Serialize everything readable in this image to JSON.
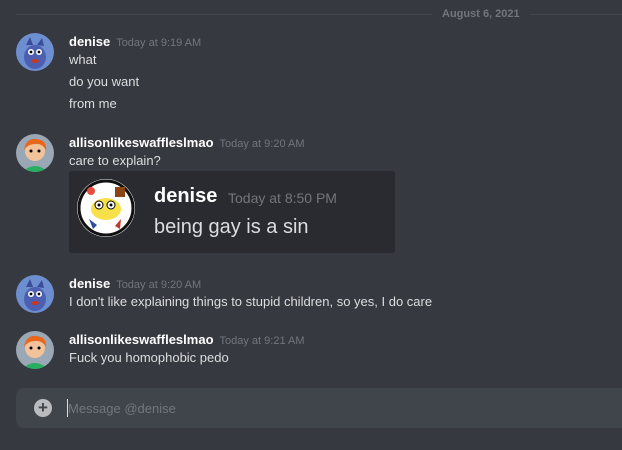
{
  "date_divider": "August 6, 2021",
  "messages": [
    {
      "username": "denise",
      "timestamp": "Today at 9:19 AM",
      "lines": [
        "what",
        "do you want",
        "from me"
      ]
    },
    {
      "username": "allisonlikeswaffleslmao",
      "timestamp": "Today at 9:20 AM",
      "lines": [
        "care to explain?"
      ],
      "embed": {
        "username": "denise",
        "timestamp": "Today at 8:50 PM",
        "text": "being gay is a sin"
      }
    },
    {
      "username": "denise",
      "timestamp": "Today at 9:20 AM",
      "lines": [
        "I don't like explaining things to stupid children, so yes, I do care"
      ]
    },
    {
      "username": "allisonlikeswaffleslmao",
      "timestamp": "Today at 9:21 AM",
      "lines": [
        "Fuck you homophobic pedo"
      ]
    }
  ],
  "composer": {
    "placeholder": "Message @denise",
    "add_icon": "+"
  },
  "colors": {
    "background": "#36393f",
    "composer": "#40444b",
    "username": "#ffffff",
    "timestamp": "#72767d"
  }
}
